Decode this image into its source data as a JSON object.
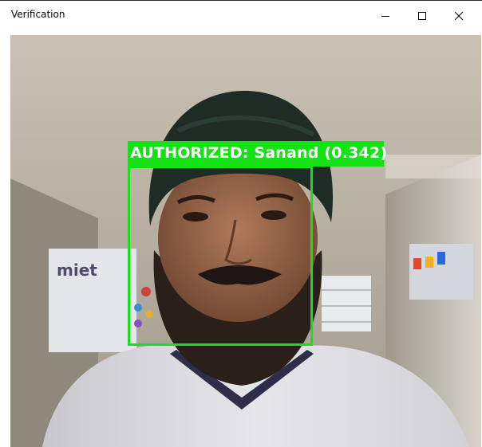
{
  "window": {
    "title": "Verification",
    "controls": {
      "minimize_icon": "minimize-icon",
      "maximize_icon": "maximize-icon",
      "close_icon": "close-icon"
    }
  },
  "detection": {
    "label": "AUTHORIZED: Sanand (0.342)",
    "box_color": "#16e016",
    "text_color": "#ffffff"
  },
  "camera": {
    "poster_text": "miet"
  }
}
